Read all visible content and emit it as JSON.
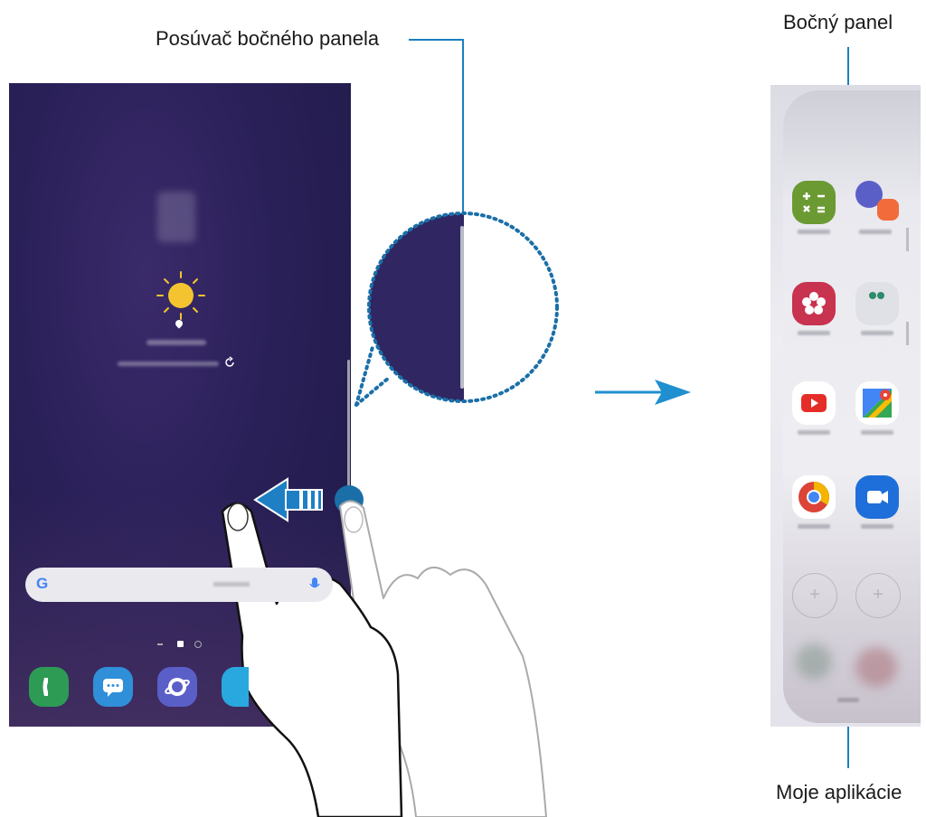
{
  "callouts": {
    "edge_handle": "Posúvač bočného panela",
    "edge_panel": "Bočný panel",
    "my_apps": "Moje aplikácie"
  },
  "icons": {
    "weather": "sun-icon",
    "location": "pin-icon",
    "refresh": "refresh-icon",
    "search_brand": "G",
    "search_mic": "mic-icon",
    "swipe_arrow": "arrow-left-icon",
    "transition_arrow": "arrow-right-icon",
    "hand": "hand-pointing-icon"
  },
  "colors": {
    "callout_line": "#1b7fbf",
    "arrow": "#1f8fd0",
    "touch_dot": "#1b6fa8"
  }
}
